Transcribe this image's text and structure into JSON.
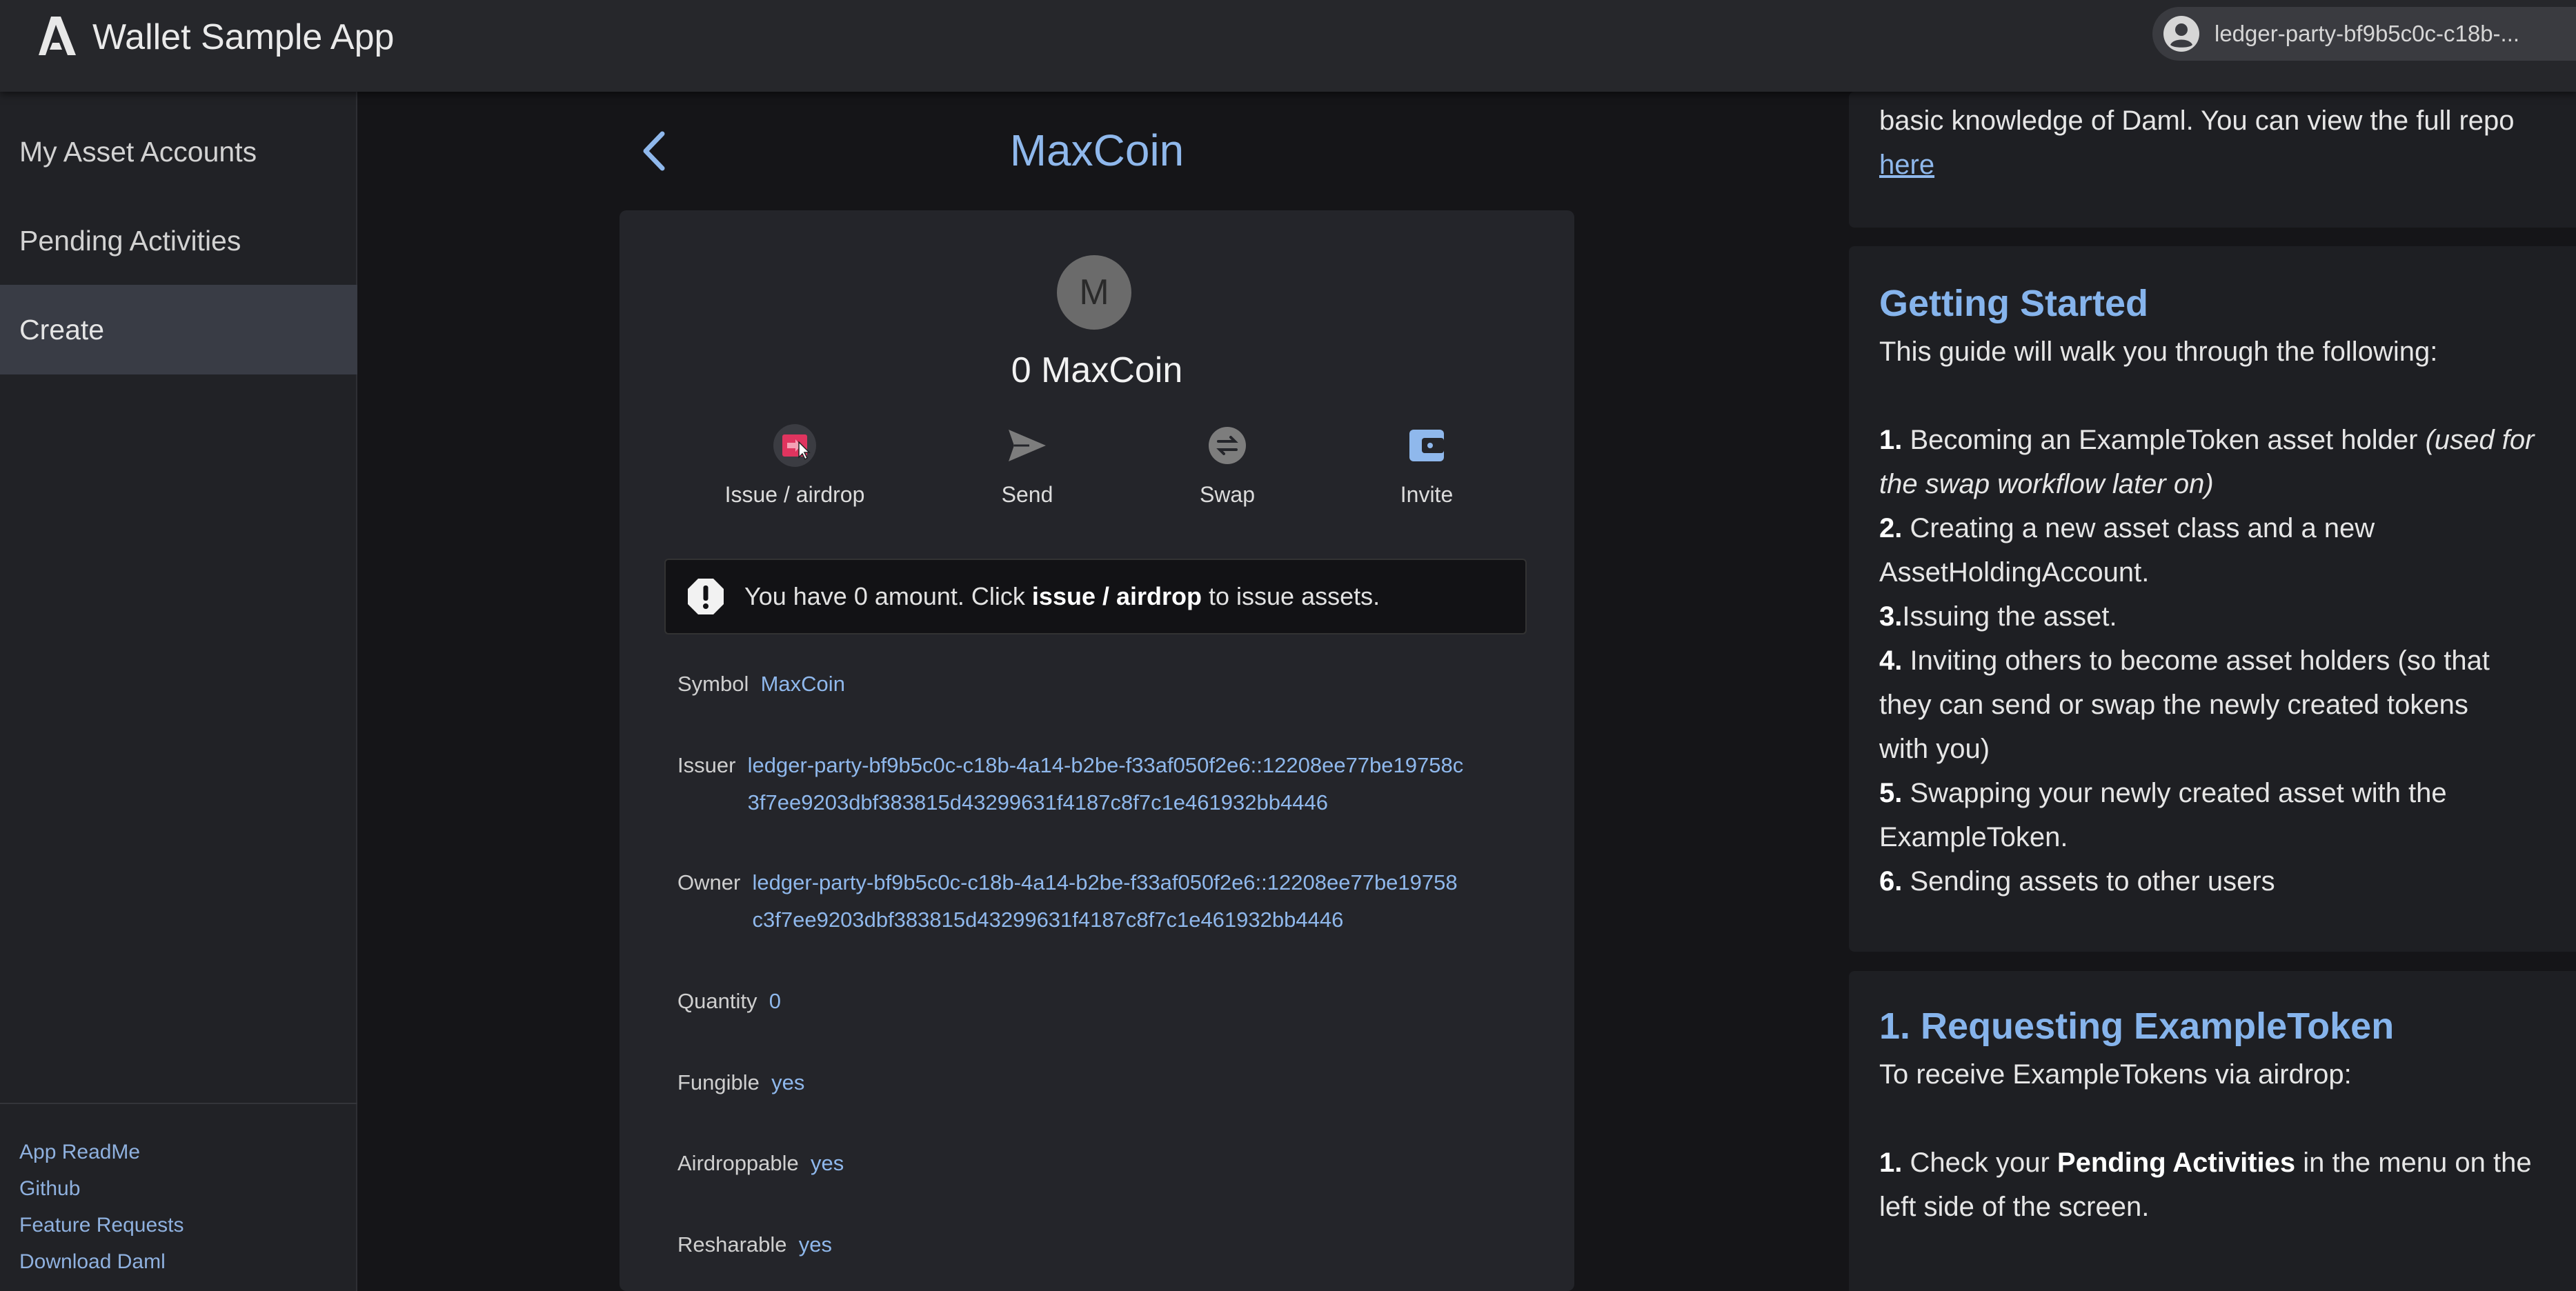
{
  "header": {
    "app_title": "Wallet Sample App",
    "logo_icon": "daml-logo-icon",
    "user_icon": "account-circle-icon",
    "user_name": "ledger-party-bf9b5c0c-c18b-..."
  },
  "sidebar": {
    "items": [
      {
        "label": "My Asset Accounts",
        "active": false
      },
      {
        "label": "Pending Activities",
        "active": false
      },
      {
        "label": "Create",
        "active": true
      }
    ],
    "footer_links": [
      "App ReadMe",
      "Github",
      "Feature Requests",
      "Download Daml"
    ]
  },
  "main": {
    "back_icon": "chevron-left-icon",
    "title": "MaxCoin",
    "avatar_letter": "M",
    "balance": "0  MaxCoin",
    "actions": [
      {
        "label": "Issue / airdrop",
        "icon": "issue-icon",
        "color": "#e0345f"
      },
      {
        "label": "Send",
        "icon": "send-icon",
        "color": "#7d7d7d"
      },
      {
        "label": "Swap",
        "icon": "swap-icon",
        "color": "#7d7d7d"
      },
      {
        "label": "Invite",
        "icon": "wallet-icon",
        "color": "#8fb8ec"
      }
    ],
    "alert": {
      "icon": "exclamation-icon",
      "prefix": "You have 0 amount. Click ",
      "bold": "issue / airdrop",
      "suffix": " to issue assets."
    },
    "fields": {
      "symbol": {
        "label": "Symbol",
        "value": "MaxCoin"
      },
      "issuer": {
        "label": "Issuer",
        "line1": "ledger-party-bf9b5c0c-c18b-4a14-b2be-f33af050f2e6::12208ee77be19758c",
        "line2": "3f7ee9203dbf383815d43299631f4187c8f7c1e461932bb4446"
      },
      "owner": {
        "label": "Owner",
        "line1": "ledger-party-bf9b5c0c-c18b-4a14-b2be-f33af050f2e6::12208ee77be19758",
        "line2": "c3f7ee9203dbf383815d43299631f4187c8f7c1e461932bb4446"
      },
      "quantity": {
        "label": "Quantity",
        "value": "0"
      },
      "fungible": {
        "label": "Fungible",
        "value": "yes"
      },
      "airdroppable": {
        "label": "Airdroppable",
        "value": "yes"
      },
      "resharable": {
        "label": "Resharable",
        "value": "yes"
      }
    }
  },
  "guide": {
    "intro_line1": "basic knowledge of Daml. You can view the full repo",
    "intro_link": "here",
    "getting_started": {
      "heading": "Getting Started",
      "lead": "This guide will walk you through the following:",
      "steps": [
        {
          "num": "1.",
          "text": " Becoming an ExampleToken asset holder ",
          "italic1": "(used for",
          "italic2": "the swap workflow later on)"
        },
        {
          "num": "2.",
          "text1": " Creating a new asset class and a new",
          "text2": "AssetHoldingAccount."
        },
        {
          "num": "3.",
          "text": "Issuing the asset."
        },
        {
          "num": "4.",
          "text1": " Inviting others to become asset holders (so that",
          "text2": "they can send or swap the newly created tokens",
          "text3": "with you)"
        },
        {
          "num": "5.",
          "text1": " Swapping your newly created asset with the",
          "text2": "ExampleToken."
        },
        {
          "num": "6.",
          "text": " Sending assets to other users"
        }
      ]
    },
    "requesting": {
      "heading": "1. Requesting ExampleToken",
      "lead": "To receive ExampleTokens via airdrop:",
      "step_num": "1.",
      "step_pre": " Check your ",
      "step_bold": "Pending Activities",
      "step_post": " in the menu on the",
      "step_line2": "left side of the screen."
    }
  }
}
